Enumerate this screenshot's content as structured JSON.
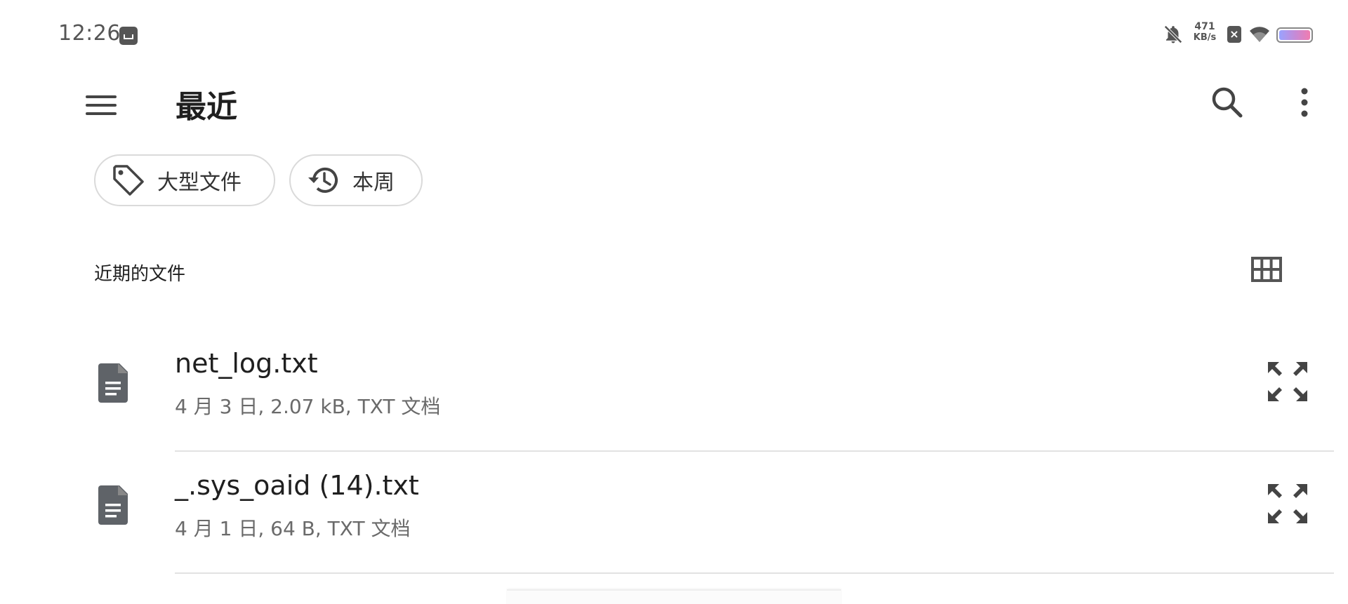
{
  "status_bar": {
    "time": "12:26",
    "net_speed_value": "471",
    "net_speed_unit": "KB/s",
    "icons": [
      "screenshot-app-icon",
      "bell-off-icon",
      "sim-x-icon",
      "wifi-icon",
      "battery-icon"
    ]
  },
  "app_bar": {
    "title": "最近",
    "icons": [
      "menu-icon",
      "search-icon",
      "more-vert-icon"
    ]
  },
  "chips": [
    {
      "label": "大型文件",
      "icon": "tag-icon"
    },
    {
      "label": "本周",
      "icon": "history-icon"
    }
  ],
  "section": {
    "title": "近期的文件",
    "view_icon": "grid-view-icon"
  },
  "files": [
    {
      "name": "net_log.txt",
      "meta": "4 月 3 日, 2.07 kB, TXT 文档",
      "icon": "document-icon",
      "action_icon": "expand-icon"
    },
    {
      "name": "_.sys_oaid (14).txt",
      "meta": "4 月 1 日, 64 B, TXT 文档",
      "icon": "document-icon",
      "action_icon": "expand-icon"
    }
  ],
  "partial_file": {
    "name": ""
  },
  "colors": {
    "icon_gray": "#5f6368",
    "divider": "#e2e2e2",
    "meta_text": "#6a6a6a",
    "chip_border": "#dadada"
  }
}
